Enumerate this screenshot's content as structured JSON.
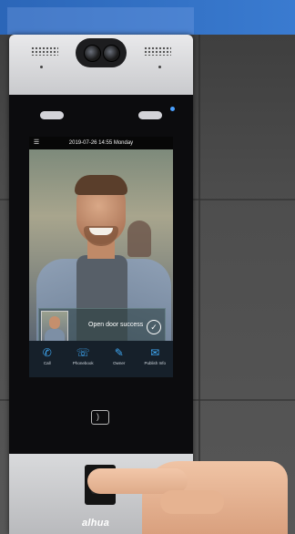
{
  "header": {},
  "screen": {
    "status_text": "2019-07-26 14:55 Monday",
    "notice_text": "Open door success",
    "menu": [
      {
        "icon": "phone-icon",
        "label": "Call"
      },
      {
        "icon": "phonebook-icon",
        "label": "Phonebook"
      },
      {
        "icon": "owner-icon",
        "label": "Owner"
      },
      {
        "icon": "publish-info-icon",
        "label": "Publish Info"
      }
    ]
  },
  "brand": {
    "logo_text": "alhua"
  },
  "colors": {
    "accent": "#3fa9f5",
    "banner": "#2b66b8"
  }
}
